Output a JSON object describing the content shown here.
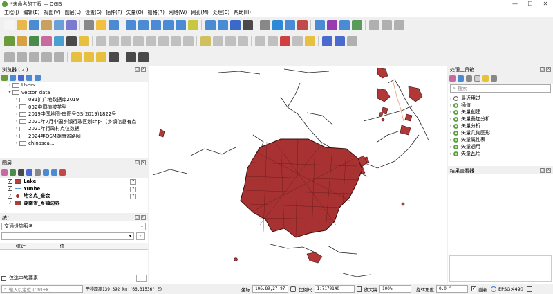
{
  "window": {
    "title": "*未命名的工程 — QGIS",
    "controls": [
      "—",
      "☐",
      "✕"
    ]
  },
  "menu": [
    "工程(J)",
    "编辑(E)",
    "视图(V)",
    "图层(L)",
    "设置(S)",
    "插件(P)",
    "矢量(O)",
    "栅格(R)",
    "网络(W)",
    "网孔(M)",
    "处理(C)",
    "帮助(H)"
  ],
  "toolbar_colors": {
    "row1": [
      "#f5f5f5",
      "#e8b84a",
      "#4a8bd4",
      "#c8a060",
      "#6a9fd8",
      "#7a7ad0",
      "#888",
      "#f2c040",
      "#4a8bd4",
      "#4a8bd4",
      "#4a8bd4",
      "#4a8bd4",
      "#4a8bd4",
      "#4a8bd4",
      "#c8c840",
      "#4a8bd4",
      "#4a8bd4",
      "#3a6ac8",
      "#4a4a4a",
      "#888",
      "#2a8ad8",
      "#4a8bd4",
      "#c04a4a",
      "#4a8bd4",
      "#9a3ab0",
      "#4a8bd4",
      "#5a9a5a",
      "#b0b0b0",
      "#b0b0b0",
      "#b0b0b0"
    ],
    "row2": [
      "#6a9a3a",
      "#d8a040",
      "#4a8a4a",
      "#c86aa0",
      "#4aa0d0",
      "#4a4a4a",
      "#e8c040",
      "#c0c0c0",
      "#c0c0c0",
      "#c0c0c0",
      "#c0c0c0",
      "#c0c0c0",
      "#c0c0c0",
      "#c0c0c0",
      "#c0c0c0",
      "#d0c060",
      "#c0c0c0",
      "#c0c0c0",
      "#c0c0c0",
      "#c0c0c0",
      "#c0c0c0",
      "#d04040",
      "#c0c0c0",
      "#e8c040",
      "#4a6ad0",
      "#4a6ad0",
      "#b0b0b0"
    ],
    "row3": [
      "#b0b0b0",
      "#b0b0b0",
      "#b0b0b0",
      "#b0b0b0",
      "#b0b0b0",
      "#e8c040",
      "#e8c040",
      "#e8c040",
      "#4a4a4a",
      "#4a4a4a",
      "#4a4a4a"
    ]
  },
  "browser": {
    "title": "浏览器 ( 2 )",
    "items": [
      {
        "indent": 1,
        "label": "Users",
        "expanded": false
      },
      {
        "indent": 1,
        "label": "vector_data",
        "expanded": true
      },
      {
        "indent": 2,
        "label": "031扩广地数据库2019",
        "expanded": false
      },
      {
        "indent": 2,
        "label": "032中国植被类型",
        "expanded": false
      },
      {
        "indent": 2,
        "label": "2019中国地图-审图号GS(2019)1822号",
        "expanded": false
      },
      {
        "indent": 2,
        "label": "2021年7月中国乡镇行政区划shp-（乡镇信息有点",
        "expanded": false
      },
      {
        "indent": 2,
        "label": "2021年行政村点位数据",
        "expanded": false
      },
      {
        "indent": 2,
        "label": "2024年OSM湖南省路网",
        "expanded": false
      },
      {
        "indent": 2,
        "label": "chinasca...",
        "expanded": false
      }
    ]
  },
  "layers": {
    "title": "图层",
    "items": [
      {
        "name": "Lake",
        "symbol": "fill",
        "color": "#c43c3c"
      },
      {
        "name": "Yunhe",
        "symbol": "line",
        "color": "#5a9ad8"
      },
      {
        "name": "地名点_查会",
        "symbol": "point",
        "color": "#a03030"
      },
      {
        "name": "湖南省_乡镇边界",
        "symbol": "fill",
        "color": "#b83838"
      }
    ],
    "flag": "?"
  },
  "stats": {
    "title": "统计",
    "layer_select": "交通设施服务",
    "col_stat": "统计",
    "col_value": "值",
    "only_selected": "仅选中的要素",
    "more": "…"
  },
  "processing": {
    "title": "处理工具箱",
    "search_placeholder": "搜索",
    "items": [
      "最近用过",
      "插值",
      "矢量创建",
      "矢量叠加分析",
      "矢量分析",
      "矢量几何图形",
      "矢量属性表",
      "矢量通用",
      "矢量瓦片"
    ]
  },
  "results": {
    "title": "结果查看器"
  },
  "status": {
    "locate_placeholder": "输入以定位 (Ctrl+K)",
    "message": "平移距离139.392 km (66.31536° E)",
    "coord_label": "坐标",
    "coord_value": "106.89,27.97",
    "scale_label": "比例尺",
    "scale_value": "1:7179140",
    "zoom_label": "放大镜",
    "zoom_value": "100%",
    "rotation_label": "旋转角度",
    "rotation_value": "0.0 °",
    "render_label": "渲染",
    "crs": "EPSG:4490"
  }
}
